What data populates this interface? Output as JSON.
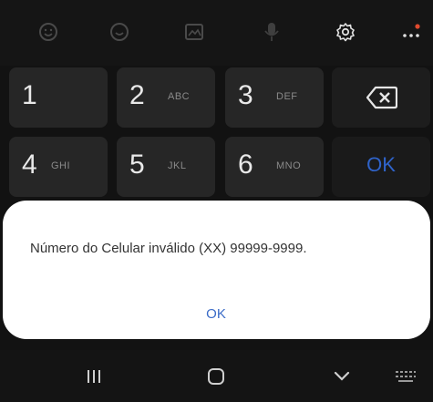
{
  "toolbar": {
    "icons": [
      "emoji-icon",
      "sticker-icon",
      "gif-icon",
      "mic-icon",
      "settings-icon",
      "more-icon"
    ]
  },
  "keypad": {
    "keys": [
      {
        "num": "1",
        "letters": ""
      },
      {
        "num": "2",
        "letters": "ABC"
      },
      {
        "num": "3",
        "letters": "DEF"
      },
      {
        "num": "4",
        "letters": "GHI"
      },
      {
        "num": "5",
        "letters": "JKL"
      },
      {
        "num": "6",
        "letters": "MNO"
      }
    ],
    "ok_label": "OK",
    "accent": "#2f63c9"
  },
  "dialog": {
    "message": "Número do Celular inválido (XX) 99999-9999.",
    "ok_label": "OK"
  },
  "navbar": {
    "icons": [
      "recents-icon",
      "home-icon",
      "back-icon",
      "keyboard-icon"
    ]
  }
}
